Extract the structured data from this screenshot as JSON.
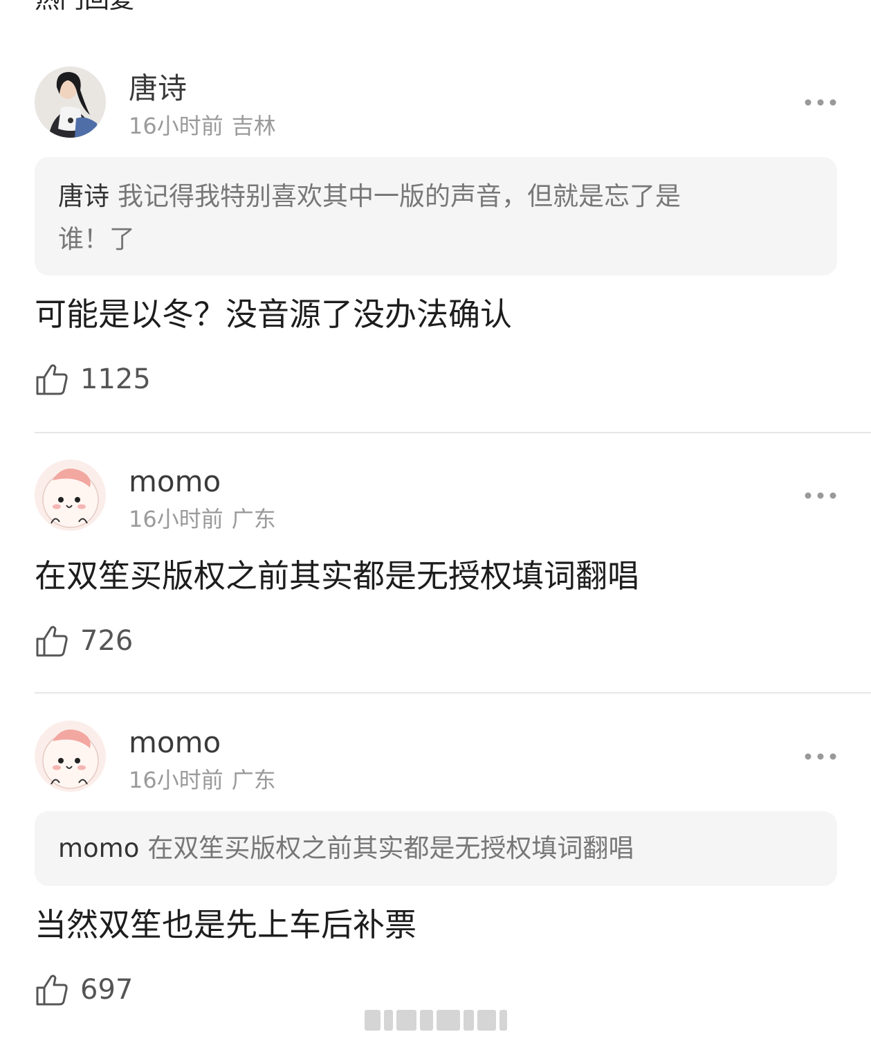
{
  "section_title": "热门回复",
  "comments": [
    {
      "username": "唐诗",
      "time": "16小时前",
      "location": "吉林",
      "quote": {
        "name": "唐诗",
        "text": "我记得我特别喜欢其中一版的声音，但就是忘了是",
        "text_line2": "谁！了"
      },
      "text": "可能是以冬？没音源了没办法确认",
      "likes": "1125"
    },
    {
      "username": "momo",
      "time": "16小时前",
      "location": "广东",
      "text": "在双笙买版权之前其实都是无授权填词翻唱",
      "likes": "726"
    },
    {
      "username": "momo",
      "time": "16小时前",
      "location": "广东",
      "quote": {
        "name": "momo",
        "text": "在双笙买版权之前其实都是无授权填词翻唱"
      },
      "text": "当然双笙也是先上车后补票",
      "likes": "697"
    }
  ],
  "colors": {
    "username": "#3a3a3a",
    "meta": "#9a9a9a",
    "quote_bg": "#f5f5f5",
    "divider": "#e6e6e6"
  },
  "icons": {
    "more": "more-dots-icon",
    "like": "thumbs-up-icon",
    "avatar_1": "avatar-photo-girl",
    "avatar_2": "avatar-cartoon-face"
  }
}
